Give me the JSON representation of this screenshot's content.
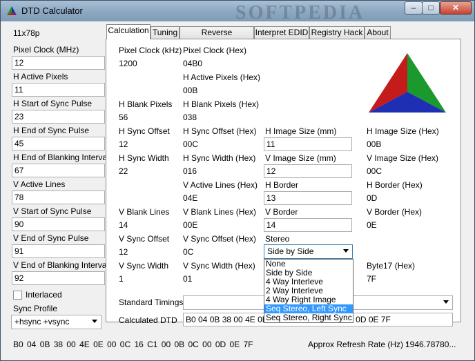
{
  "window": {
    "title": "DTD Calculator",
    "watermark": "SOFTPEDIA"
  },
  "titlebar_buttons": {
    "minimize": "–",
    "maximize": "□",
    "close": "✕"
  },
  "left_panel": {
    "mode": "11x78p",
    "fields": [
      {
        "label": "Pixel Clock (MHz)",
        "value": "12"
      },
      {
        "label": "H Active Pixels",
        "value": "11"
      },
      {
        "label": "H Start of Sync Pulse",
        "value": "23"
      },
      {
        "label": "H End of Sync Pulse",
        "value": "45"
      },
      {
        "label": "H End of Blanking Interval",
        "value": "67"
      },
      {
        "label": "V Active Lines",
        "value": "78"
      },
      {
        "label": "V Start of Sync Pulse",
        "value": "90"
      },
      {
        "label": "V End of Sync Pulse",
        "value": "91"
      },
      {
        "label": "V End of Blanking Interval",
        "value": "92"
      }
    ],
    "interlaced_label": "Interlaced",
    "interlaced_checked": false,
    "sync_profile_label": "Sync Profile",
    "sync_profile_value": "+hsync +vsync"
  },
  "tabs": [
    {
      "label": "Calculation",
      "active": true
    },
    {
      "label": "Tuning"
    },
    {
      "label": "Reverse Calculation"
    },
    {
      "label": "Interpret EDID"
    },
    {
      "label": "Registry Hack"
    },
    {
      "label": "About"
    }
  ],
  "calc": {
    "pixel_clock_khz": {
      "label": "Pixel Clock (kHz)",
      "value": "1200"
    },
    "pixel_clock_hex": {
      "label": "Pixel Clock (Hex)",
      "value": "04B0"
    },
    "h_active_hex": {
      "label": "H Active Pixels (Hex)",
      "value": "00B"
    },
    "h_blank": {
      "label": "H Blank Pixels",
      "value": "56"
    },
    "h_blank_hex": {
      "label": "H Blank Pixels (Hex)",
      "value": "038"
    },
    "h_sync_offset": {
      "label": "H Sync Offset",
      "value": "12"
    },
    "h_sync_offset_hex": {
      "label": "H Sync Offset (Hex)",
      "value": "00C"
    },
    "h_image_size": {
      "label": "H Image Size (mm)",
      "value": "11"
    },
    "h_image_size_hex": {
      "label": "H Image Size (Hex)",
      "value": "00B"
    },
    "h_sync_width": {
      "label": "H Sync Width",
      "value": "22"
    },
    "h_sync_width_hex": {
      "label": "H Sync Width (Hex)",
      "value": "016"
    },
    "v_image_size": {
      "label": "V Image Size (mm)",
      "value": "12"
    },
    "v_image_size_hex": {
      "label": "V Image Size (Hex)",
      "value": "00C"
    },
    "v_active_hex": {
      "label": "V Active Lines (Hex)",
      "value": "04E"
    },
    "h_border": {
      "label": "H Border",
      "value": "13"
    },
    "h_border_hex": {
      "label": "H Border (Hex)",
      "value": "0D"
    },
    "v_blank": {
      "label": "V Blank Lines",
      "value": "14"
    },
    "v_blank_hex": {
      "label": "V Blank Lines (Hex)",
      "value": "00E"
    },
    "v_border": {
      "label": "V Border",
      "value": "14"
    },
    "v_border_hex": {
      "label": "V Border (Hex)",
      "value": "0E"
    },
    "v_sync_offset": {
      "label": "V Sync Offset",
      "value": "12"
    },
    "v_sync_offset_hex": {
      "label": "V Sync Offset (Hex)",
      "value": "0C"
    },
    "stereo": {
      "label": "Stereo",
      "value": "Side by Side"
    },
    "v_sync_width": {
      "label": "V Sync Width",
      "value": "1"
    },
    "v_sync_width_hex": {
      "label": "V Sync Width (Hex)",
      "value": "01"
    },
    "byte17": {
      "label": "Byte17 (Hex)",
      "value": "7F"
    },
    "standard_timings_label": "Standard Timings",
    "standard_timings_value": "",
    "calculated_dtd_label": "Calculated DTD",
    "calculated_dtd_value": "B0 04 0B 38 00 4E 0E 0C 16 C1 00 0B 0C 00 0D 0E 7F"
  },
  "stereo_options": [
    {
      "label": "None"
    },
    {
      "label": "Side by Side"
    },
    {
      "label": "4 Way Interleve"
    },
    {
      "label": "2 Way Interleve"
    },
    {
      "label": "4 Way Right Image"
    },
    {
      "label": "Seq Stereo, Left Sync",
      "highlighted": true
    },
    {
      "label": "Seq Stereo, Right Sync"
    }
  ],
  "status": {
    "dtd_bytes": "B0  04  0B  38  00  4E  0E  00  0C  16  C1  00  0B  0C  00  0D  0E  7F",
    "refresh_label": "Approx Refresh Rate (Hz) :",
    "refresh_value": "1946.78780..."
  },
  "colors": {
    "triangle_top": "#1a9a2c",
    "triangle_left": "#c41b1b",
    "triangle_right": "#1f2fb4"
  }
}
